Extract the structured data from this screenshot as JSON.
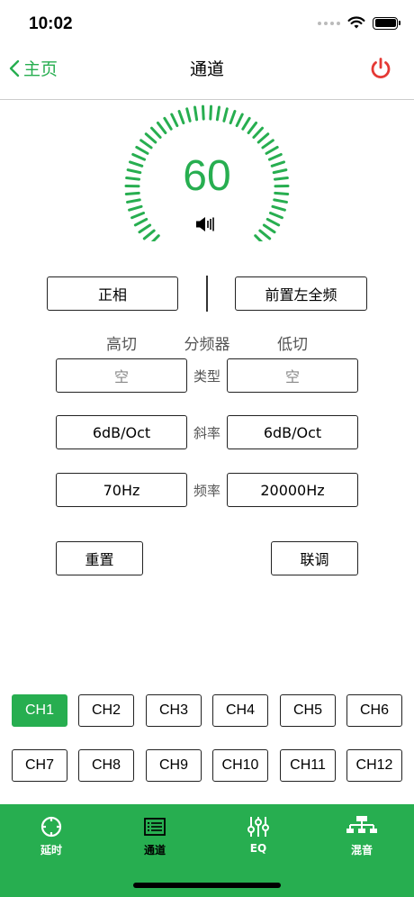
{
  "status": {
    "time": "10:02"
  },
  "nav": {
    "back_label": "主页",
    "title": "通道"
  },
  "colors": {
    "accent": "#27ae50",
    "power": "#e53935"
  },
  "volume": {
    "value": "60",
    "level": 0.6
  },
  "phase_button": "正相",
  "source_button": "前置左全频",
  "crossover": {
    "high_cut_label": "高切",
    "title": "分频器",
    "low_cut_label": "低切",
    "rows": [
      {
        "label": "类型",
        "high": "空",
        "low": "空"
      },
      {
        "label": "斜率",
        "high": "6dB/Oct",
        "low": "6dB/Oct"
      },
      {
        "label": "频率",
        "high": "70Hz",
        "low": "20000Hz"
      }
    ]
  },
  "actions": {
    "reset": "重置",
    "link": "联调"
  },
  "channels": [
    "CH1",
    "CH2",
    "CH3",
    "CH4",
    "CH5",
    "CH6",
    "CH7",
    "CH8",
    "CH9",
    "CH10",
    "CH11",
    "CH12"
  ],
  "active_channel": "CH1",
  "tabs": [
    {
      "label": "延时",
      "icon": "crosshair-icon"
    },
    {
      "label": "通道",
      "icon": "list-icon",
      "active": true
    },
    {
      "label": "EQ",
      "icon": "sliders-icon"
    },
    {
      "label": "混音",
      "icon": "hierarchy-icon"
    }
  ]
}
